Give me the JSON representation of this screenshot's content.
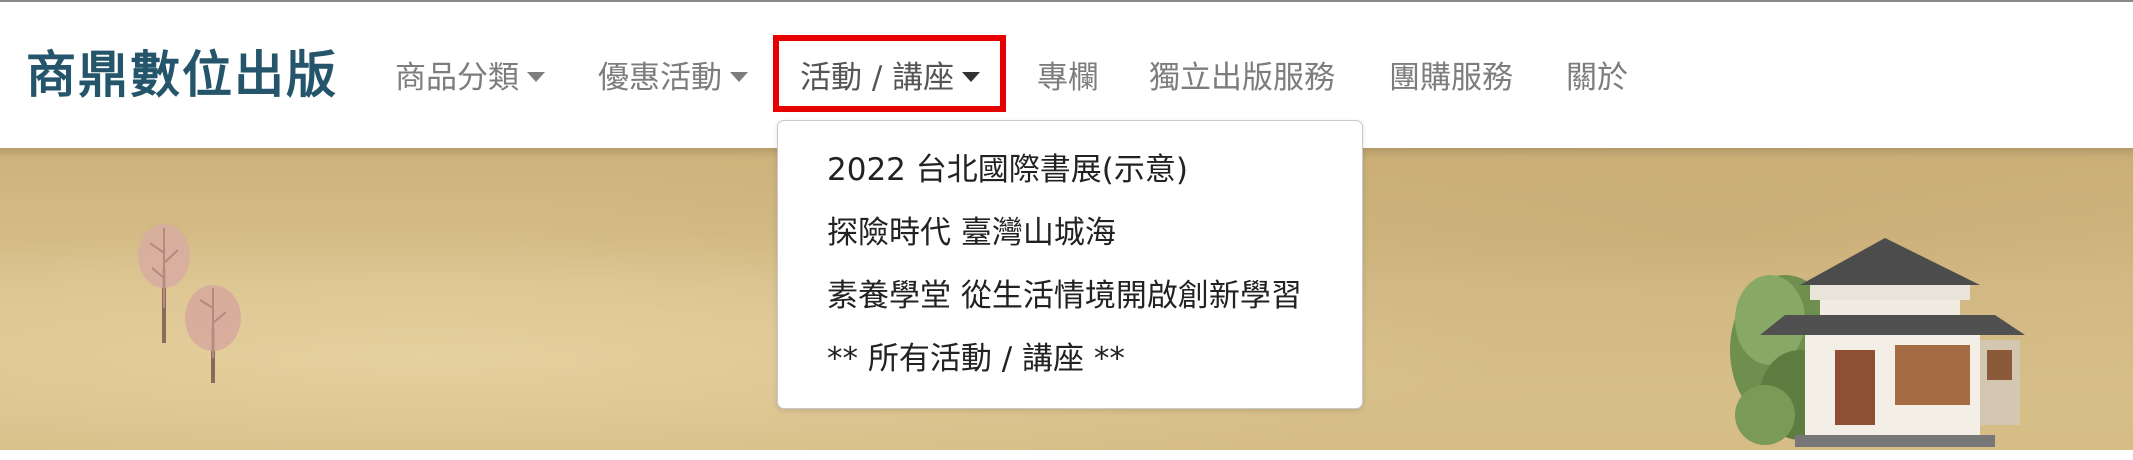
{
  "brand": {
    "name": "商鼎數位出版"
  },
  "nav": {
    "items": [
      {
        "label": "商品分類",
        "has_caret": true
      },
      {
        "label": "優惠活動",
        "has_caret": true
      },
      {
        "label": "活動 / 講座",
        "has_caret": true,
        "active": true
      },
      {
        "label": "專欄",
        "has_caret": false
      },
      {
        "label": "獨立出版服務",
        "has_caret": false
      },
      {
        "label": "團購服務",
        "has_caret": false
      },
      {
        "label": "關於",
        "has_caret": false
      }
    ]
  },
  "dropdown": {
    "items": [
      {
        "label": "2022 台北國際書展(示意)"
      },
      {
        "label": "探險時代 臺灣山城海"
      },
      {
        "label": "素養學堂 從生活情境開啟創新學習"
      },
      {
        "label": "** 所有活動 / 講座 **"
      }
    ]
  },
  "colors": {
    "brand": "#24556b",
    "nav_text": "#7d7d7d",
    "highlight": "#e60000",
    "banner": "#d3b981"
  }
}
